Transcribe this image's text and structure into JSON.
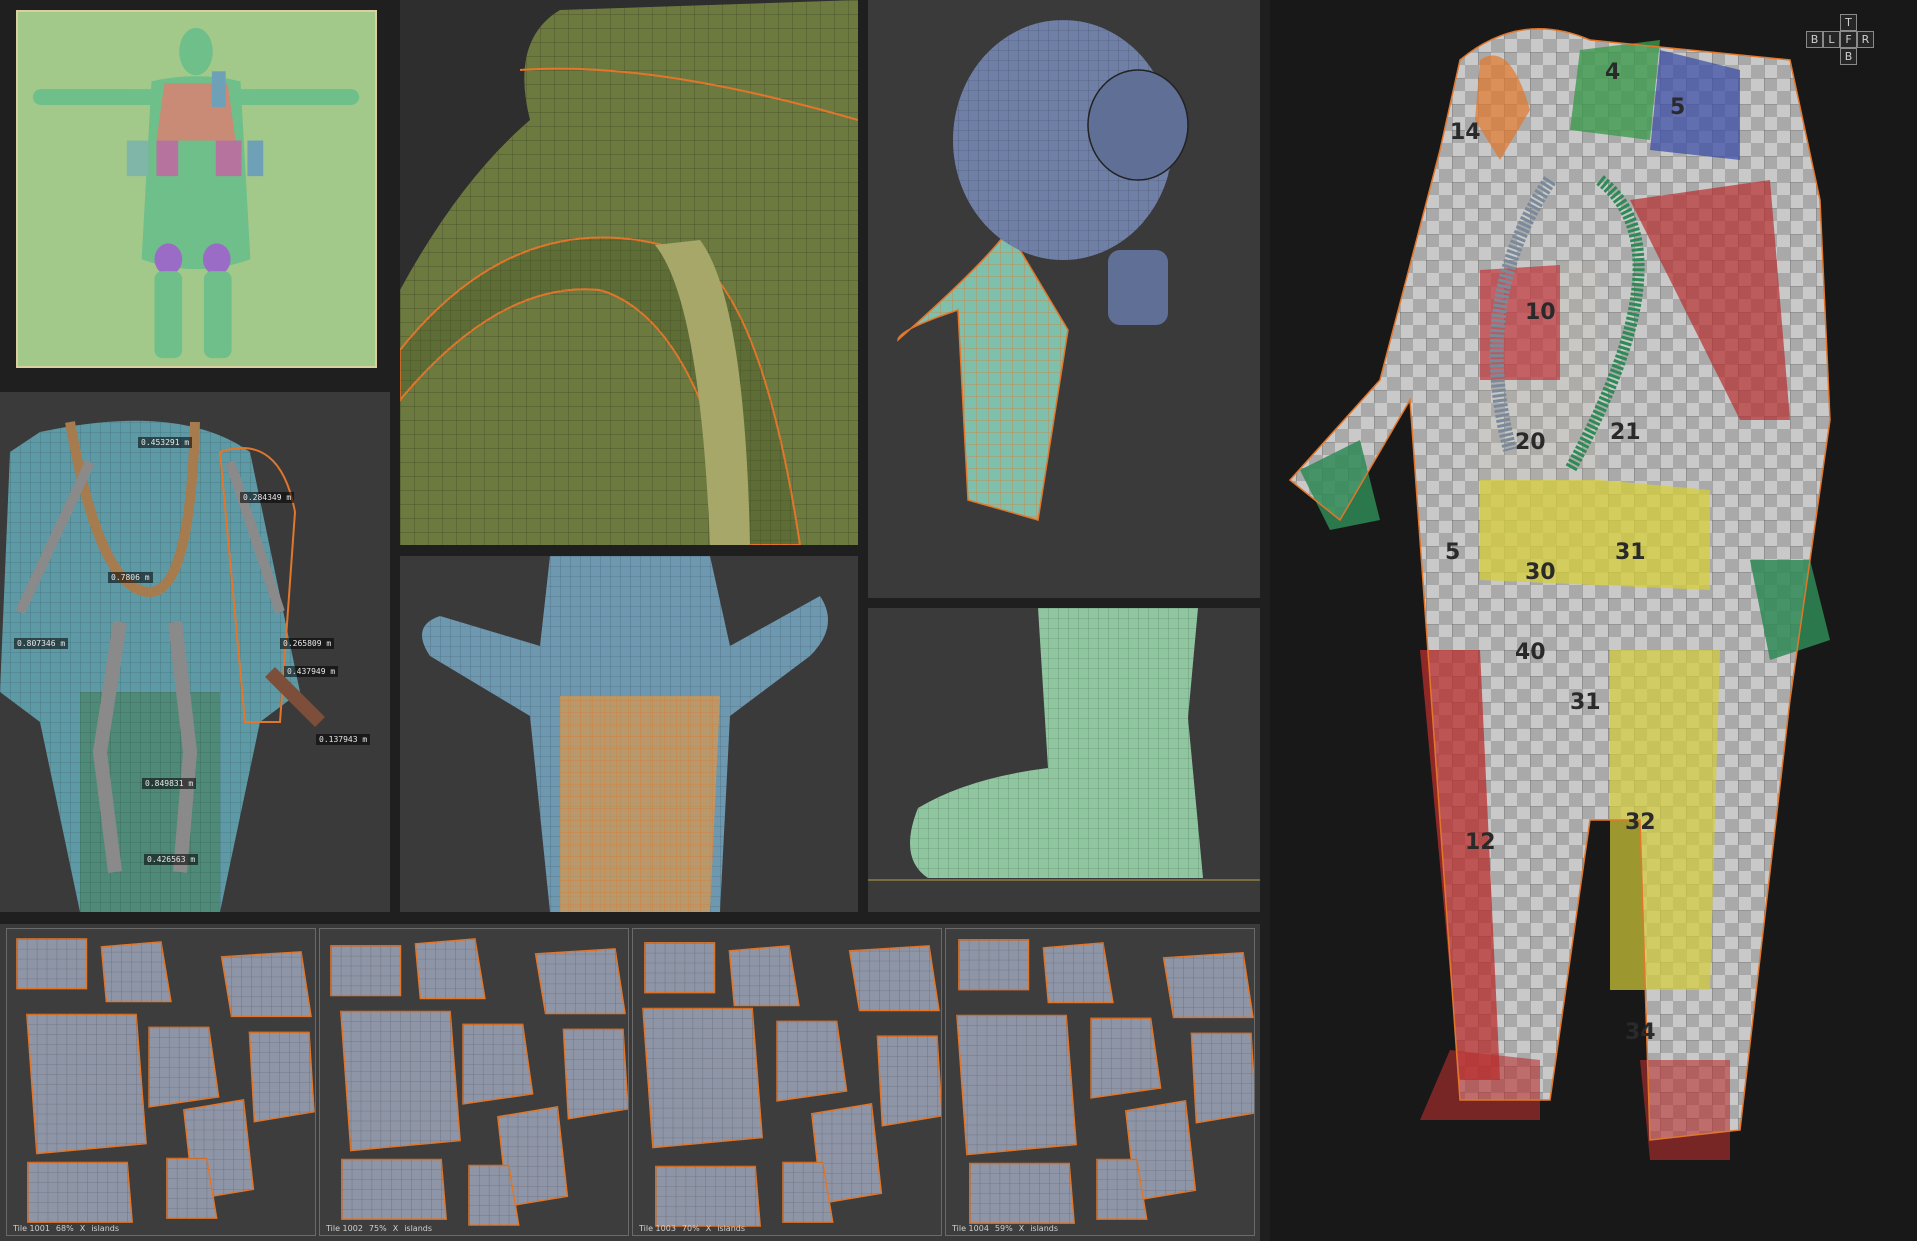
{
  "viewports": {
    "rig": {
      "measurements": [
        "0.453291 m",
        "0.284349 m",
        "0.807346 m",
        "0.7806 m",
        "0.265809 m",
        "0.437949 m",
        "0.137943 m",
        "0.849831 m",
        "0.426563 m"
      ]
    }
  },
  "uv_tiles": [
    {
      "tile": "Tile 1001",
      "pct": "68%",
      "x": "X",
      "islands": "islands"
    },
    {
      "tile": "Tile 1002",
      "pct": "75%",
      "x": "X",
      "islands": "islands"
    },
    {
      "tile": "Tile 1003",
      "pct": "70%",
      "x": "X",
      "islands": "islands"
    },
    {
      "tile": "Tile 1004",
      "pct": "59%",
      "x": "X",
      "islands": "islands"
    }
  ],
  "checker_numbers": [
    "10",
    "20",
    "21",
    "5",
    "30",
    "31",
    "40",
    "31",
    "32",
    "12",
    "34",
    "4",
    "5",
    "14"
  ],
  "nav_cube": {
    "top": "T",
    "back": "B",
    "left": "L",
    "front": "F",
    "right": "R",
    "bottom": "B"
  },
  "colors": {
    "selection_orange": "#e2762a",
    "panel_bg": "#3a3a3a",
    "uv_island": "#8e95a6",
    "tpose_bg": "#a3c98a"
  }
}
